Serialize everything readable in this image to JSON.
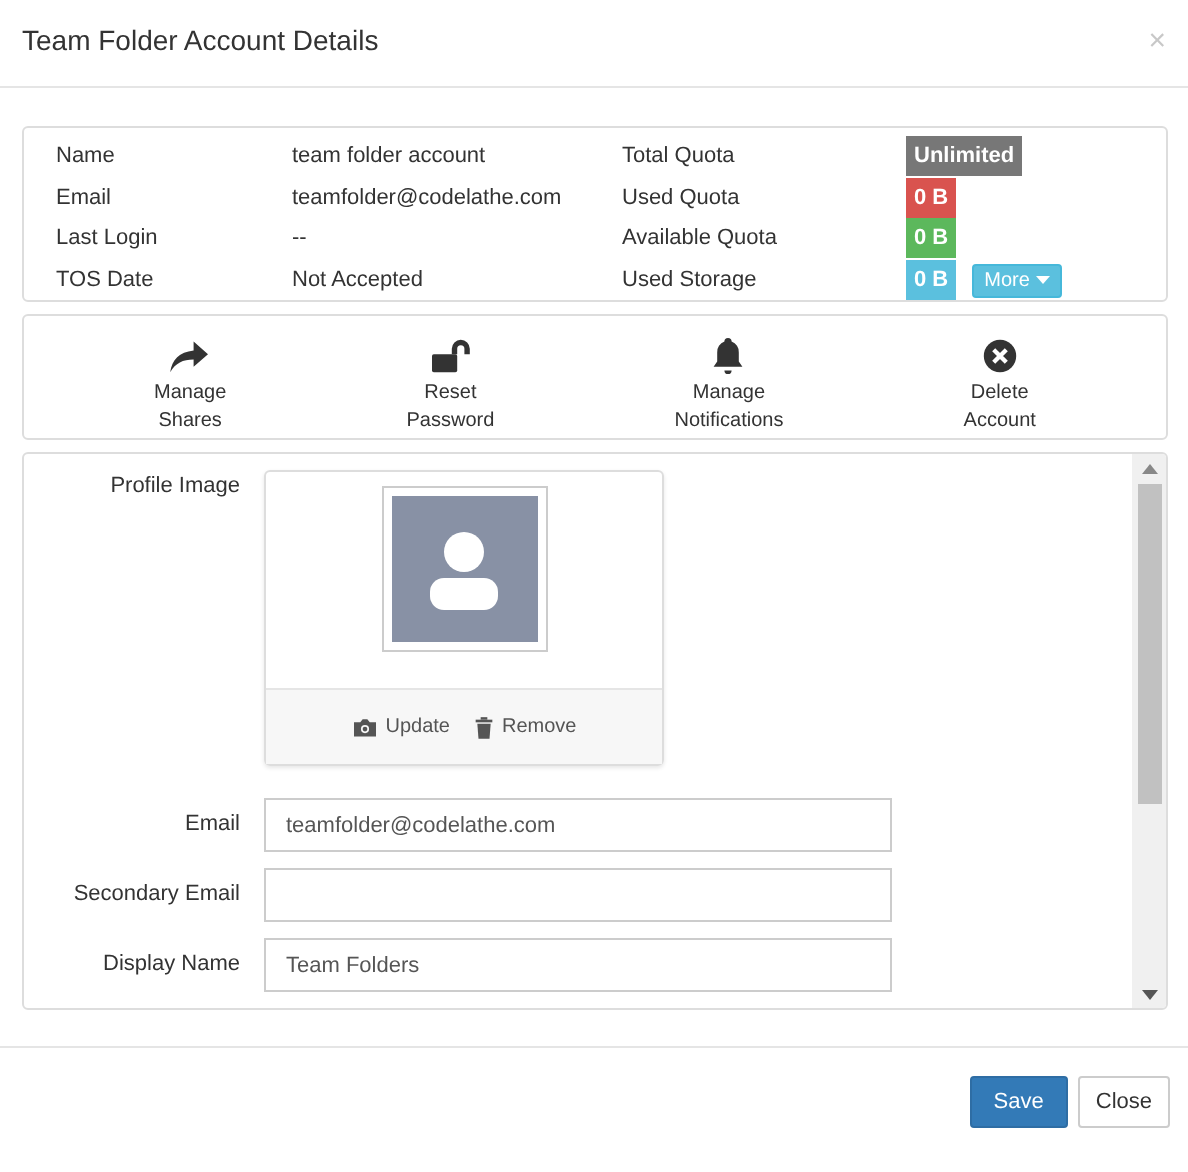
{
  "dialog": {
    "title": "Team Folder Account Details",
    "close": "×"
  },
  "info": [
    {
      "label": "Name",
      "value": "team folder account"
    },
    {
      "label": "Email",
      "value": "teamfolder@codelathe.com"
    },
    {
      "label": "Last Login",
      "value": "--"
    },
    {
      "label": "TOS Date",
      "value": "Not Accepted"
    }
  ],
  "quota": [
    {
      "label": "Total Quota",
      "value": "Unlimited",
      "color": "#777777"
    },
    {
      "label": "Used Quota",
      "value": "0 B",
      "color": "#d9534f"
    },
    {
      "label": "Available Quota",
      "value": "0 B",
      "color": "#5cb85c"
    },
    {
      "label": "Used Storage",
      "value": "0 B",
      "color": "#5bc0de"
    }
  ],
  "more_button": "More",
  "actions": [
    {
      "label": "Manage Shares",
      "kind": "share"
    },
    {
      "label": "Reset Password",
      "kind": "unlock"
    },
    {
      "label": "Manage Notifications",
      "kind": "bell"
    },
    {
      "label": "Delete Account",
      "kind": "delete"
    }
  ],
  "profile_image": {
    "label": "Profile Image",
    "buttons": [
      {
        "label": "Update",
        "kind": "camera"
      },
      {
        "label": "Remove",
        "kind": "trash"
      }
    ]
  },
  "fields": [
    {
      "label": "Email",
      "value": "teamfolder@codelathe.com"
    },
    {
      "label": "Secondary Email"
    },
    {
      "label": "Display Name",
      "value": "Team Folders"
    }
  ],
  "footer_buttons": [
    {
      "label": "Save",
      "kind": "primary"
    },
    {
      "label": "Close",
      "kind": "default"
    }
  ]
}
